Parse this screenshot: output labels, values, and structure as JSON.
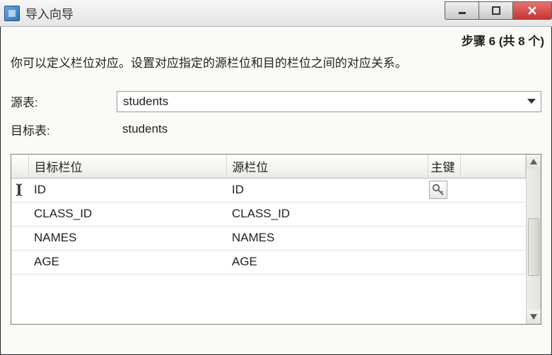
{
  "titlebar": {
    "title": "导入向导"
  },
  "step": {
    "text": "步骤 6 (共 8 个)"
  },
  "description": "你可以定义栏位对应。设置对应指定的源栏位和目的栏位之间的对应关系。",
  "form": {
    "source_table_label": "源表:",
    "target_table_label": "目标表:",
    "source_table_value": "students",
    "target_table_value": "students"
  },
  "grid": {
    "headers": {
      "target": "目标栏位",
      "source": "源栏位",
      "key": "主键"
    },
    "rows": [
      {
        "target": "ID",
        "source": "ID",
        "is_pk": true,
        "indicator": "text-cursor"
      },
      {
        "target": "CLASS_ID",
        "source": "CLASS_ID",
        "is_pk": false,
        "indicator": ""
      },
      {
        "target": "NAMES",
        "source": "NAMES",
        "is_pk": false,
        "indicator": ""
      },
      {
        "target": "AGE",
        "source": "AGE",
        "is_pk": false,
        "indicator": ""
      }
    ]
  }
}
